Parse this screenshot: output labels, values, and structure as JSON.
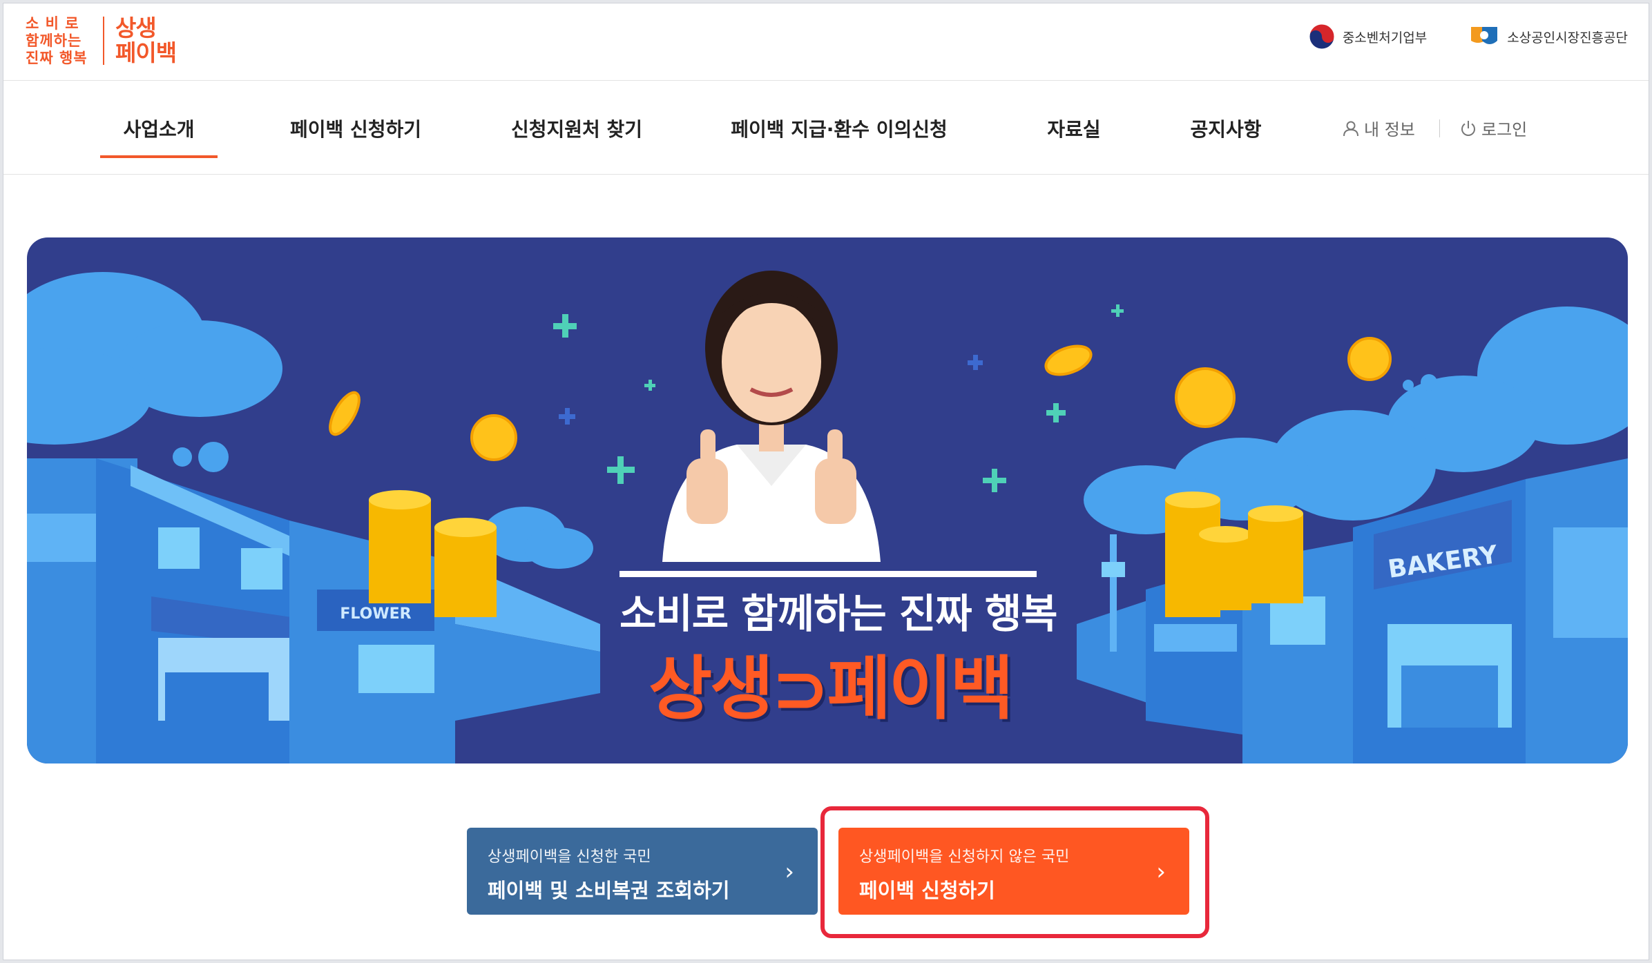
{
  "logo": {
    "slogan_line1": "소 비 로",
    "slogan_line2": "함께하는",
    "slogan_line3": "진짜 행복",
    "brand_line1": "상생",
    "brand_line2": "페이백"
  },
  "agencies": [
    {
      "name": "중소벤처기업부",
      "icon": "korea-government-emblem-icon"
    },
    {
      "name": "소상공인시장진흥공단",
      "icon": "semas-logo-icon"
    }
  ],
  "nav": {
    "items": [
      {
        "label": "사업소개",
        "active": true
      },
      {
        "label": "페이백 신청하기",
        "active": false
      },
      {
        "label": "신청지원처 찾기",
        "active": false
      },
      {
        "label": "페이백 지급·환수 이의신청",
        "active": false
      },
      {
        "label": "자료실",
        "active": false
      },
      {
        "label": "공지사항",
        "active": false
      }
    ],
    "my_info": "내 정보",
    "login": "로그인",
    "accent_color": "#f2582a"
  },
  "banner": {
    "subtitle": "소비로 함께하는 진짜 행복",
    "title": "상생⊃페이백",
    "shop_sign_left": "FLOWER",
    "shop_sign_right": "BAKERY",
    "background_color": "#313e8c"
  },
  "cta": {
    "inquiry": {
      "sub": "상생페이백을 신청한 국민",
      "main": "페이백 및 소비복권 조회하기",
      "color": "#3b6a9b"
    },
    "apply": {
      "sub": "상생페이백을 신청하지 않은 국민",
      "main": "페이백 신청하기",
      "color": "#ff5722"
    },
    "arrow": "›"
  }
}
